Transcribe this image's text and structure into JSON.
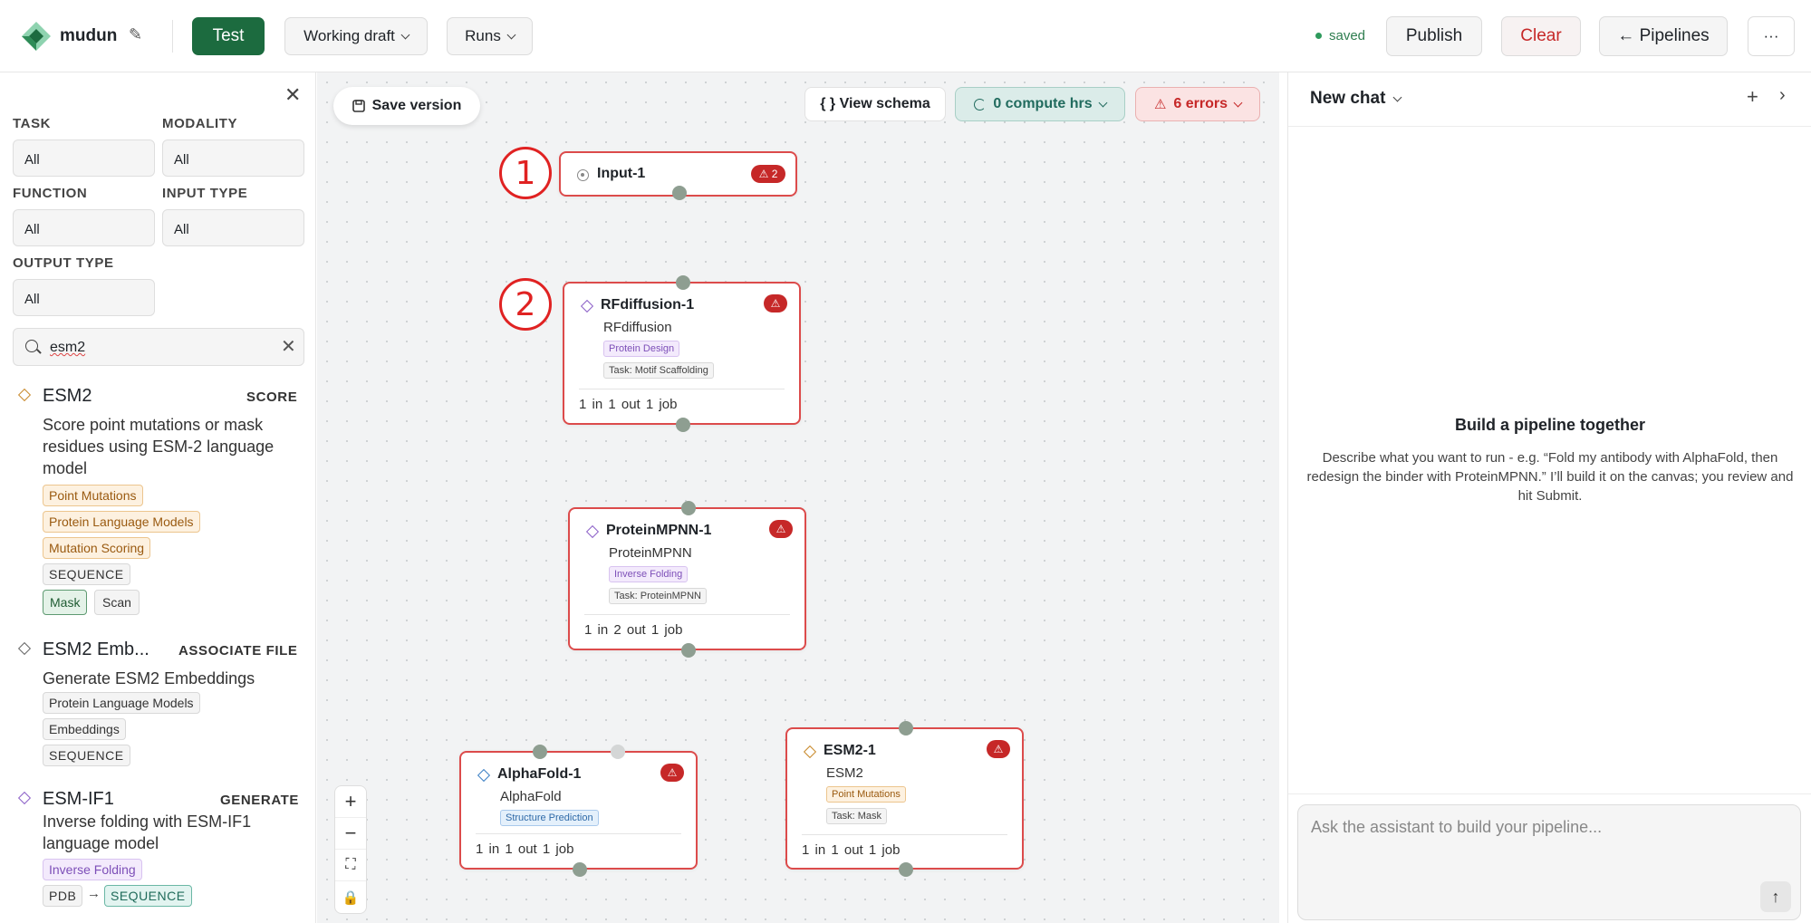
{
  "header": {
    "app_name": "mudun",
    "test_label": "Test",
    "draft_label": "Working draft",
    "runs_label": "Runs",
    "saved_label": "saved",
    "publish_label": "Publish",
    "clear_label": "Clear",
    "pipelines_label": "← Pipelines",
    "more_label": "···"
  },
  "filters": {
    "task": {
      "label": "TASK",
      "value": "All"
    },
    "modality": {
      "label": "MODALITY",
      "value": "All"
    },
    "function": {
      "label": "FUNCTION",
      "value": "All"
    },
    "input_type": {
      "label": "INPUT TYPE",
      "value": "All"
    },
    "output_type": {
      "label": "OUTPUT TYPE",
      "value": "All"
    },
    "search_value": "esm2"
  },
  "results": [
    {
      "title": "ESM2",
      "kind": "SCORE",
      "desc": "Score point mutations or mask residues using ESM-2 language model",
      "tags": [
        "Point Mutations",
        "Protein Language Models",
        "Mutation Scoring",
        "SEQUENCE"
      ],
      "modes": [
        "Mask",
        "Scan"
      ]
    },
    {
      "title": "ESM2 Emb...",
      "kind": "ASSOCIATE FILE",
      "desc": "Generate ESM2 Embeddings",
      "tags": [
        "Protein Language Models",
        "Embeddings",
        "SEQUENCE"
      ]
    },
    {
      "title": "ESM-IF1",
      "kind": "GENERATE",
      "desc": "Inverse folding with ESM-IF1 language model",
      "tags": [
        "Inverse Folding",
        "PDB",
        "SEQUENCE"
      ],
      "arrow": "→"
    }
  ],
  "canvas": {
    "save_version_label": "Save version",
    "view_schema_label": "{ } View schema",
    "compute_label": "0 compute hrs",
    "errors_label": "6 errors",
    "annotations": [
      "1",
      "2"
    ],
    "nodes": [
      {
        "title": "Input-1",
        "warn": "⚠ 2"
      },
      {
        "title": "RFdiffusion-1",
        "subtitle": "RFdiffusion",
        "tag1": "Protein Design",
        "tag2": "Task: Motif Scaffolding",
        "footer": "1 in  1 out  1 job",
        "warn": "⚠"
      },
      {
        "title": "ProteinMPNN-1",
        "subtitle": "ProteinMPNN",
        "tag1": "Inverse Folding",
        "tag2": "Task: ProteinMPNN",
        "footer": "1 in  2 out  1 job",
        "warn": "⚠"
      },
      {
        "title": "AlphaFold-1",
        "subtitle": "AlphaFold",
        "tag1": "Structure Prediction",
        "footer": "1 in  1 out  1 job",
        "warn": "⚠"
      },
      {
        "title": "ESM2-1",
        "subtitle": "ESM2",
        "tag1": "Point Mutations",
        "tag2": "Task: Mask",
        "footer": "1 in  1 out  1 job",
        "warn": "⚠"
      }
    ]
  },
  "chat": {
    "title": "New chat",
    "plus_label": "+",
    "next_label": "›",
    "empty_title": "Build a pipeline together",
    "empty_desc": "Describe what you want to run - e.g. “Fold my antibody with AlphaFold, then redesign the binder with ProteinMPNN.” I’ll build it on the canvas; you review and hit Submit.",
    "placeholder": "Ask the assistant to build your pipeline...",
    "send_label": "↑"
  },
  "colors": {
    "primary": "#1c6b3f",
    "error": "#c62828",
    "accent_teal": "#216b5e"
  }
}
